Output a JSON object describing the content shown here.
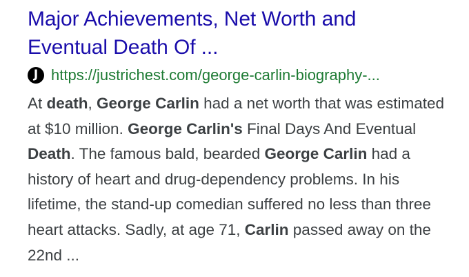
{
  "result": {
    "title_line1": "Major Achievements, Net Worth and",
    "title_line2": "Eventual Death Of ...",
    "favicon": {
      "icon": "justrichest-logo-icon",
      "letter": "J"
    },
    "url": "https://justrichest.com/george-carlin-biography-...",
    "snippet": [
      {
        "text": "At ",
        "bold": false
      },
      {
        "text": "death",
        "bold": true
      },
      {
        "text": ", ",
        "bold": false
      },
      {
        "text": "George Carlin",
        "bold": true
      },
      {
        "text": " had a net worth that was estimated at $10 million. ",
        "bold": false
      },
      {
        "text": "George Carlin's",
        "bold": true
      },
      {
        "text": " Final Days And Eventual ",
        "bold": false
      },
      {
        "text": "Death",
        "bold": true
      },
      {
        "text": ". The famous bald, bearded ",
        "bold": false
      },
      {
        "text": "George Carlin",
        "bold": true
      },
      {
        "text": " had a history of heart and drug-dependency problems. In his lifetime, the stand-up comedian suffered no less than three heart attacks. Sadly, at age 71, ",
        "bold": false
      },
      {
        "text": "Carlin",
        "bold": true
      },
      {
        "text": " passed away on the 22nd ...",
        "bold": false
      }
    ]
  },
  "colors": {
    "title": "#1a0dab",
    "url": "#1e7b34",
    "snippet": "#3c4043",
    "favicon_bg": "#000000"
  }
}
